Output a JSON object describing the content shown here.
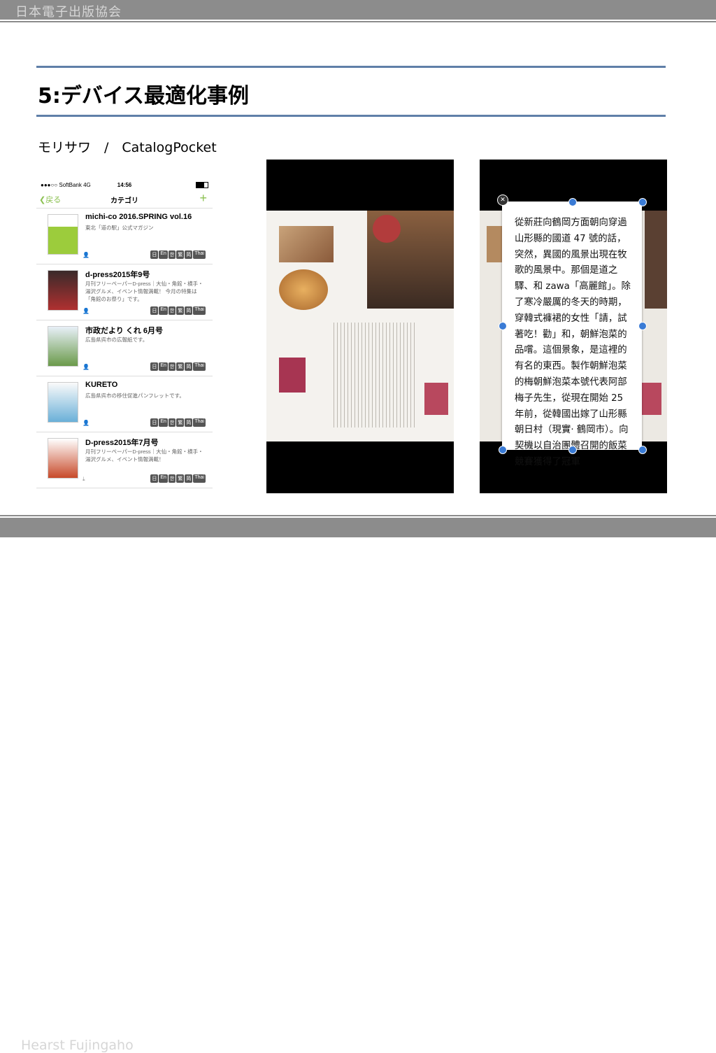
{
  "header": {
    "org": "日本電子出版協会"
  },
  "slide": {
    "title": "5:デバイス最適化事例",
    "subtitle": "モリサワ　/　CatalogPocket"
  },
  "footer": {
    "text": "Hearst Fujingaho"
  },
  "phone": {
    "carrier": "●●●○○ SoftBank  4G",
    "time": "14:56",
    "back_label": "❮戻る",
    "nav_title": "カテゴリ",
    "add_label": "+",
    "items": [
      {
        "title": "michi-co 2016.SPRING vol.16",
        "desc": "東北「道の駅」公式マガジン"
      },
      {
        "title": "d-press2015年9号",
        "desc": "月刊フリーペーパーD-press｜大仙・角館・横手・湯沢グルメ、イベント情報満載！ 今月の特集は「角館のお祭り」です。"
      },
      {
        "title": "市政だより くれ 6月号",
        "desc": "広島県呉市の広報紙です。"
      },
      {
        "title": "KURETO",
        "desc": "広島県呉市の移住促進パンフレットです。"
      },
      {
        "title": "D-press2015年7月号",
        "desc": "月刊フリーペーパーD-press｜大仙・角館・横手・湯沢グルメ、イベント情報満載！"
      }
    ],
    "lang_badges": [
      "日",
      "En",
      "한",
      "繁",
      "简",
      "Thai"
    ]
  },
  "popup": {
    "text": "從新莊向鶴岡方面朝向穿過山形縣的國道 47 號的話，突然，異國的風景出現在牧歌的風景中。那個是道之驛、和 zawa「高麗館」。除了寒冷嚴厲的冬天的時期，穿韓式褲裙的女性「請，試著吃！勸」和，朝鮮泡菜的品嚐。這個景象，是這裡的有名的東西。製作朝鮮泡菜的梅朝鮮泡菜本號代表阿部梅子先生，從現在開始 25 年前，從韓國出嫁了山形縣朝日村（現實· 鶴岡市）。向契機以自治團體召開的飯菜競賽獲得了冠軍"
  },
  "colors": {
    "bar": "#8c8c8c",
    "rule": "#5f7fa8",
    "accent": "#8cc152",
    "handle": "#3a7bd5"
  }
}
